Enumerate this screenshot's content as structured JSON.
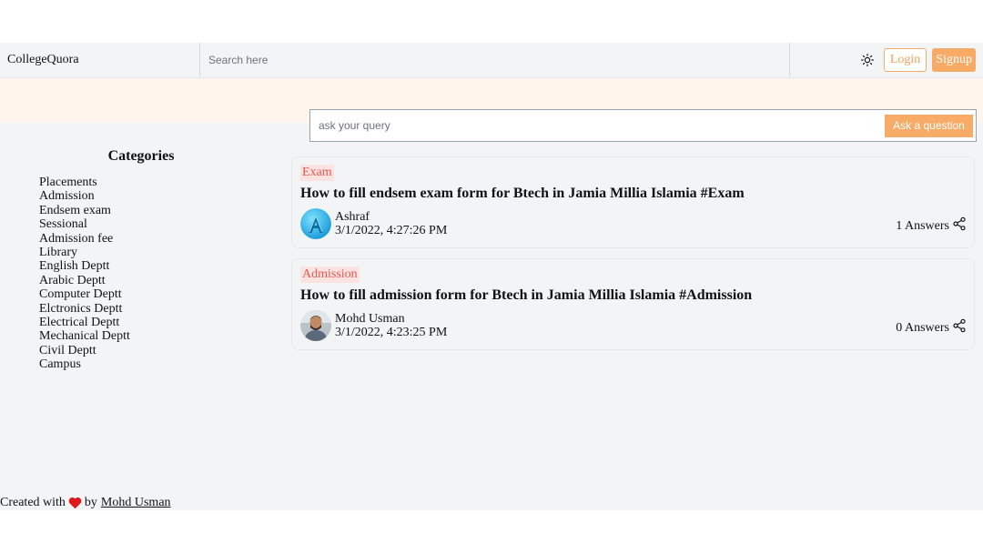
{
  "navbar": {
    "brand": "CollegeQuora",
    "search_placeholder": "Search here",
    "login_label": "Login",
    "signup_label": "Signup"
  },
  "ask": {
    "placeholder": "ask your query",
    "button_label": "Ask a question"
  },
  "categories": {
    "title": "Categories",
    "items": [
      "Placements",
      "Admission",
      "Endsem exam",
      "Sessional",
      "Admission fee",
      "Library",
      "English Deptt",
      "Arabic Deptt",
      "Computer Deptt",
      "Elctronics Deptt",
      "Electrical Deptt",
      "Mechanical Deptt",
      "Civil Deptt",
      "Campus"
    ]
  },
  "questions": [
    {
      "tag": "Exam",
      "title": "How to fill endsem exam form for Btech in Jamia Millia Islamia #Exam",
      "author": "Ashraf",
      "date": "3/1/2022, 4:27:26 PM",
      "answers": "1 Answers"
    },
    {
      "tag": "Admission",
      "title": "How to fill admission form for Btech in Jamia Millia Islamia #Admission",
      "author": "Mohd Usman",
      "date": "3/1/2022, 4:23:25 PM",
      "answers": "0 Answers"
    }
  ],
  "footer": {
    "prefix": "Created with",
    "by": "by",
    "author_link": "Mohd Usman"
  },
  "colors": {
    "accent": "#f8ab67",
    "tag_bg": "#fde2e2",
    "tag_text": "#e55a4e",
    "heart": "#e0181b"
  },
  "icons": {
    "theme_toggle": "sun-icon",
    "share": "share-icon",
    "footer": "heart-icon"
  }
}
